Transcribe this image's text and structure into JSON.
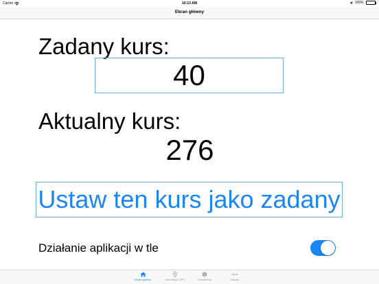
{
  "status_bar": {
    "carrier": "Carrier",
    "time": "10:13 AM",
    "battery": "100%",
    "icons": [
      "wifi-icon",
      "location-icon",
      "battery-icon"
    ]
  },
  "nav": {
    "title": "Ekran główny"
  },
  "main": {
    "set_course_label": "Zadany kurs:",
    "set_course_value": "40",
    "current_course_label": "Aktualny kurs:",
    "current_course_value": "276",
    "set_button_label": "Ustaw ten kurs jako zadany",
    "background_label": "Działanie aplikacji w tle",
    "background_enabled": true
  },
  "tabs": [
    {
      "label": "Ekran główny",
      "icon": "home-icon",
      "active": true
    },
    {
      "label": "Informacje GPS",
      "icon": "map-pin-icon",
      "active": false
    },
    {
      "label": "Ustawienia",
      "icon": "gear-icon",
      "active": false
    },
    {
      "label": "Więcej",
      "icon": "more-icon",
      "active": false
    }
  ],
  "colors": {
    "accent": "#1a86f5",
    "border": "#6aaef0",
    "inactive_tab": "#929292",
    "bar_background": "#f8f8f8"
  }
}
